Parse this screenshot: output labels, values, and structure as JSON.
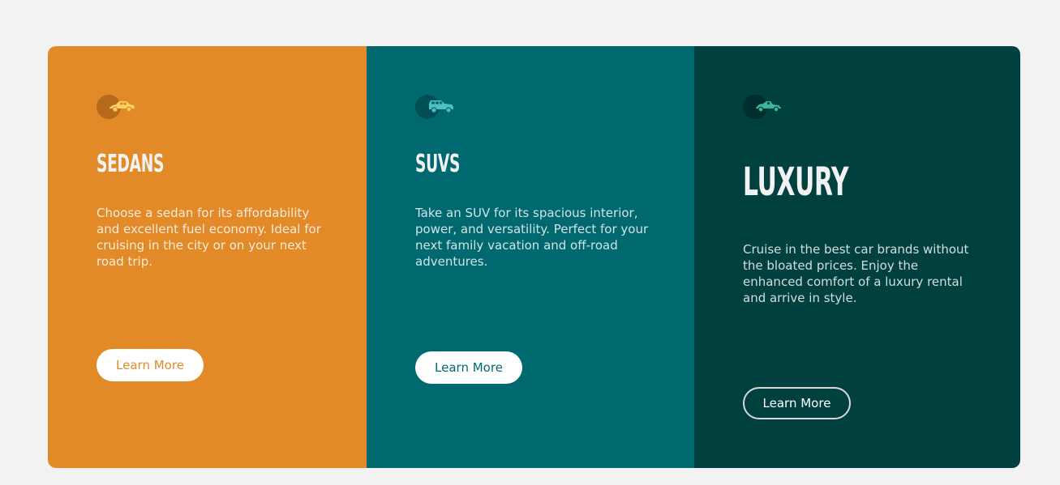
{
  "colors": {
    "page_background": "#f2f2f2",
    "sedans_bg": "#e28a27",
    "suvs_bg": "#006970",
    "luxury_bg": "#00413f",
    "icon_sedans": "#ffd066",
    "icon_suvs": "#4fc0c4",
    "icon_luxury": "#3fb49c"
  },
  "cards": [
    {
      "icon": "sedan-car-icon",
      "title": "SEDANS",
      "description": "Choose a sedan for its affordability and excellent fuel economy. Ideal for cruising in the city or on your next road trip.",
      "button_label": "Learn More"
    },
    {
      "icon": "suv-car-icon",
      "title": "SUVS",
      "description": "Take an SUV for its spacious interior, power, and versatility. Perfect for your next family vacation and off-road adventures.",
      "button_label": "Learn More"
    },
    {
      "icon": "luxury-car-icon",
      "title": "LUXURY",
      "description": "Cruise in the best car brands without the bloated prices. Enjoy the enhanced comfort of a luxury rental and arrive in style.",
      "button_label": "Learn More"
    }
  ]
}
